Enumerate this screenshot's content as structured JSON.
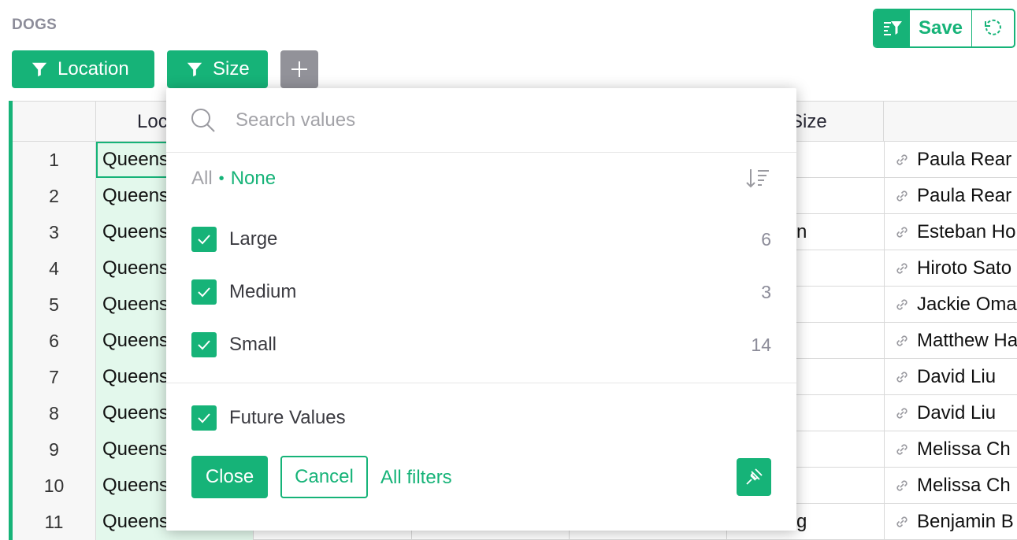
{
  "section": {
    "title": "DOGS"
  },
  "filters": [
    {
      "label": "Location"
    },
    {
      "label": "Size"
    }
  ],
  "toolbar": {
    "save_label": "Save"
  },
  "grid": {
    "headers": {
      "location": "Loc",
      "size": "Size"
    },
    "rows": [
      {
        "num": "1",
        "location": "Queens",
        "owner": "Paula Rear",
        "peek": ""
      },
      {
        "num": "2",
        "location": "Queens",
        "owner": "Paula Rear",
        "peek": ""
      },
      {
        "num": "3",
        "location": "Queens",
        "owner": "Esteban Ho",
        "peek": "n"
      },
      {
        "num": "4",
        "location": "Queens",
        "owner": "Hiroto Sato",
        "peek": ""
      },
      {
        "num": "5",
        "location": "Queens",
        "owner": "Jackie Oma",
        "peek": ""
      },
      {
        "num": "6",
        "location": "Queens",
        "owner": "Matthew Ha",
        "peek": ""
      },
      {
        "num": "7",
        "location": "Queens",
        "owner": "David Liu",
        "peek": ""
      },
      {
        "num": "8",
        "location": "Queens",
        "owner": "David Liu",
        "peek": ""
      },
      {
        "num": "9",
        "location": "Queens",
        "owner": "Melissa Ch",
        "peek": ""
      },
      {
        "num": "10",
        "location": "Queens",
        "owner": "Melissa Ch",
        "peek": ""
      },
      {
        "num": "11",
        "location": "Queens",
        "owner": "Benjamin B",
        "peek": "g"
      }
    ]
  },
  "popup": {
    "search_placeholder": "Search values",
    "all_label": "All",
    "none_label": "None",
    "options": [
      {
        "label": "Large",
        "count": "6",
        "checked": true
      },
      {
        "label": "Medium",
        "count": "3",
        "checked": true
      },
      {
        "label": "Small",
        "count": "14",
        "checked": true
      }
    ],
    "future_values_label": "Future Values",
    "close_label": "Close",
    "cancel_label": "Cancel",
    "all_filters_label": "All filters"
  },
  "colors": {
    "accent": "#16b378",
    "selected_column": "#e3f8ec",
    "add_button": "#929299"
  }
}
